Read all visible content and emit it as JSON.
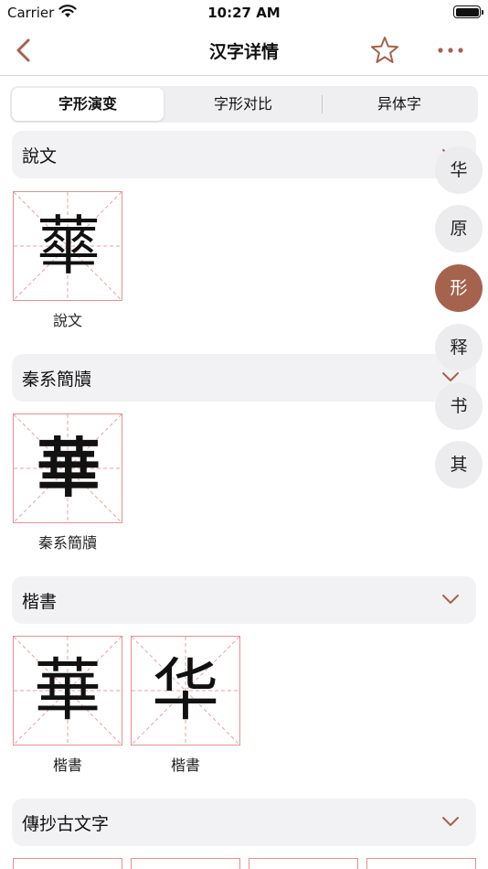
{
  "status_bar": {
    "carrier": "Carrier",
    "time": "10:27 AM"
  },
  "nav": {
    "title": "汉字详情"
  },
  "tabs": [
    {
      "label": "字形演变",
      "active": true
    },
    {
      "label": "字形对比",
      "active": false
    },
    {
      "label": "异体字",
      "active": false
    }
  ],
  "sections": [
    {
      "title": "說文",
      "glyphs": [
        {
          "char": "蕐",
          "label": "說文"
        }
      ]
    },
    {
      "title": "秦系簡牘",
      "glyphs": [
        {
          "char": "華",
          "label": "秦系簡牘"
        }
      ]
    },
    {
      "title": "楷書",
      "glyphs": [
        {
          "char": "華",
          "label": "楷書"
        },
        {
          "char": "华",
          "label": "楷書"
        }
      ]
    },
    {
      "title": "傳抄古文字",
      "glyphs": []
    }
  ],
  "side_index": [
    {
      "label": "华",
      "active": false
    },
    {
      "label": "原",
      "active": false
    },
    {
      "label": "形",
      "active": true
    },
    {
      "label": "释",
      "active": false
    },
    {
      "label": "书",
      "active": false
    },
    {
      "label": "其",
      "active": false
    }
  ],
  "colors": {
    "accent": "#a5624d",
    "grid_line": "#e59090",
    "section_bg": "#f2f2f5"
  }
}
